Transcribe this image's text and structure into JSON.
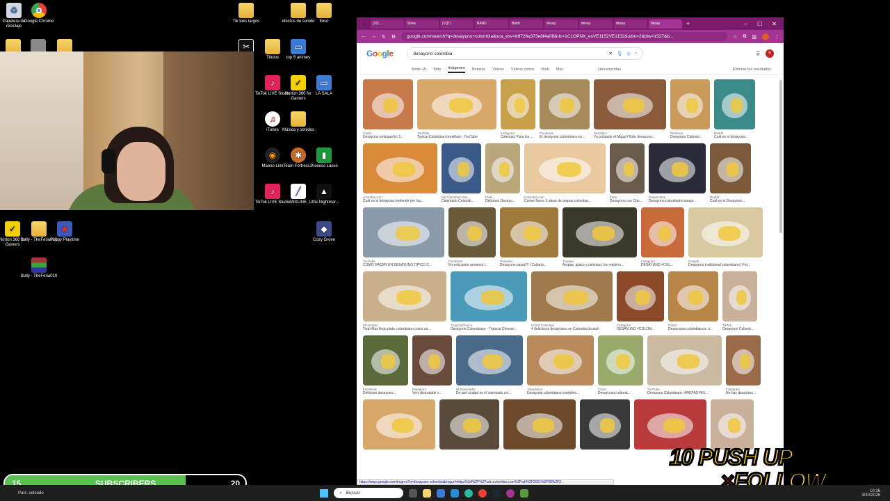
{
  "desktop": {
    "icons": [
      {
        "label": "Papelera de reciclaje",
        "icon": "recycle-bin-icon"
      },
      {
        "label": "Google Chrome",
        "icon": "chrome-icon"
      },
      {
        "label": "Tik toks largos",
        "icon": "folder-icon"
      },
      {
        "label": "efectos de sonido",
        "icon": "folder-icon"
      },
      {
        "label": "ftoso",
        "icon": "folder-icon"
      },
      {
        "label": "Títulos",
        "icon": "folder-icon"
      },
      {
        "label": "top 5 animes",
        "icon": "file-icon"
      },
      {
        "label": "TikTok LIVE Studio",
        "icon": "tiktok-icon"
      },
      {
        "label": "Norton 360 for Gamers",
        "icon": "norton-icon"
      },
      {
        "label": "LA SALA",
        "icon": "file-icon"
      },
      {
        "label": "iTunes",
        "icon": "itunes-icon"
      },
      {
        "label": "Música y sonidos",
        "icon": "folder-icon"
      },
      {
        "label": "Maono Link",
        "icon": "maono-icon"
      },
      {
        "label": "Team Fortress...",
        "icon": "tf2-icon"
      },
      {
        "label": "Process Lasso",
        "icon": "lasso-icon"
      },
      {
        "label": "TikTok LIVE Studio",
        "icon": "tiktok-icon"
      },
      {
        "label": "MIXLINE",
        "icon": "mixline-icon"
      },
      {
        "label": "Little Nightmar...",
        "icon": "game-icon"
      },
      {
        "label": "Cozy Grove",
        "icon": "game-icon"
      },
      {
        "label": "Norton 360 for Gamers",
        "icon": "norton-icon"
      },
      {
        "label": "Bully - TheFeria010",
        "icon": "folder-icon"
      },
      {
        "label": "Poppy Playtime",
        "icon": "game-icon"
      },
      {
        "label": "Bully - TheFeria010",
        "icon": "winrar-icon"
      }
    ]
  },
  "browser": {
    "tabs": [
      "(37) ...",
      "Strea",
      "(1QT)",
      "BAND",
      "Band",
      "desay",
      "desay",
      "desay",
      "desay"
    ],
    "url": "google.com/search?q=desayuno+colombia&sca_esv=b9726a373e8f4a08&rlz=1C1OPNX_esVE1152VE1152&udm=2&biw=1527&b...",
    "search_query": "desayuno colombia",
    "nav_tabs": [
      "Modo IA",
      "Todo",
      "Imágenes",
      "Noticias",
      "Videos",
      "Vídeos cortos",
      "Web",
      "Más"
    ],
    "active_tab": "Imágenes",
    "tools_label": "Herramientas",
    "safesearch_label": "Eliminar los resultados",
    "results": [
      [
        {
          "src": "Canal",
          "title": "Desayuno antioqueño: 5...",
          "color": "#c97a4a",
          "w": 72
        },
        {
          "src": "YouTube",
          "title": "Typical Colombian breakfast - YouTube",
          "color": "#d9a76a",
          "w": 114
        },
        {
          "src": "Instagram",
          "title": "Calentao: Para los ...",
          "color": "#c9a04a",
          "w": 50
        },
        {
          "src": "Facebook",
          "title": "El desayuno colombiano es...",
          "color": "#a68a5a",
          "w": 72
        },
        {
          "src": "Periódico",
          "title": "Ya probaste el Migao? Este desayuno...",
          "color": "#8a5a3a",
          "w": 104
        },
        {
          "src": "Pinterest",
          "title": "Desayuno Colomb...",
          "color": "#c99a5a",
          "w": 57
        },
        {
          "src": "Reddit",
          "title": "Cuál es el desayuno...",
          "color": "#3a8a8a",
          "w": 59
        }
      ],
      [
        {
          "src": "colombia.com",
          "title": "Cuál es el desayuno preferido por los...",
          "color": "#d98a3a",
          "w": 107
        },
        {
          "src": "My Colombian Rec...",
          "title": "Calentado Colombi...",
          "color": "#3a5a8a",
          "w": 57
        },
        {
          "src": "Flickr",
          "title": "Delicioso Desayu...",
          "color": "#b9a67a",
          "w": 50
        },
        {
          "src": "Colombia.com",
          "title": "Comer fuera: 5 ideas de arepas colombia...",
          "color": "#e9c9a0",
          "w": 117
        },
        {
          "src": "Flickr",
          "title": "Desayuno con Cho...",
          "color": "#6a5a4a",
          "w": 50
        },
        {
          "src": "Dreamstime",
          "title": "Desayuno colombiano image...",
          "color": "#2a2a3a",
          "w": 82
        },
        {
          "src": "Reddit",
          "title": "Cuál es el Desayuno...",
          "color": "#7a5a3a",
          "w": 59
        }
      ],
      [
        {
          "src": "YouTube",
          "title": "CÓMO HACER UN DESAYUNO TÍPICO C...",
          "color": "#8a9aaa",
          "w": 117
        },
        {
          "src": "Facebook",
          "title": "En esta parte amamos l...",
          "color": "#6a5a3a",
          "w": 68
        },
        {
          "src": "Pinterest",
          "title": "Desayuno paisa!!!! | Colomb...",
          "color": "#a07a3a",
          "w": 84
        },
        {
          "src": "Traveler",
          "title": "Arepas, ajiaco y calentao: los mejores...",
          "color": "#3a3a2a",
          "w": 107
        },
        {
          "src": "Instagram",
          "title": "DESAYUNO #COL...",
          "color": "#c96a3a",
          "w": 62
        },
        {
          "src": "Freepik",
          "title": "Desayuno tradicional colombiano | Fot...",
          "color": "#d9c9a0",
          "w": 107
        }
      ],
      [
        {
          "src": "El Heraldo",
          "title": "Todo Mas llego plato colombiano como un...",
          "color": "#c9b08a",
          "w": 120
        },
        {
          "src": "Tropical Choice",
          "title": "Desayuno Colombiano - Tropical Cheese...",
          "color": "#4a9ab9",
          "w": 110
        },
        {
          "src": "Unicef Colombia",
          "title": "4 deliciosos desayunos en Colombia brunch",
          "color": "#a07a4a",
          "w": 117
        },
        {
          "src": "Instagram",
          "title": "DESAYUNO #COLOM...",
          "color": "#8a4a2a",
          "w": 68
        },
        {
          "src": "Canal",
          "title": "Desayunos colombianos: u...",
          "color": "#b9864a",
          "w": 72
        },
        {
          "src": "TikTok",
          "title": "Desayuno Colomb...",
          "color": "#c9b09a",
          "w": 50
        }
      ],
      [
        {
          "src": "Facebook",
          "title": "Delicioso desayuno...",
          "color": "#5a6a3a",
          "w": 65
        },
        {
          "src": "Instagram",
          "title": "Very distrutable v...",
          "color": "#6a4a3a",
          "w": 57
        },
        {
          "src": "El Espectador",
          "title": "De qué ciudad es el calentado col...",
          "color": "#4a6a8a",
          "w": 96
        },
        {
          "src": "Tripadvisor",
          "title": "Desayuno colombiano completo...",
          "color": "#b98a5a",
          "w": 96
        },
        {
          "src": "Canal",
          "title": "Desayunos colomb...",
          "color": "#9aaa6a",
          "w": 65
        },
        {
          "src": "YouTube",
          "title": "Desayuno Colombiano, AREPAS REL...",
          "color": "#c9b9a0",
          "w": 107
        },
        {
          "src": "Instagram",
          "title": "No hay desayuno...",
          "color": "#9a6a4a",
          "w": 50
        }
      ],
      [
        {
          "src": "",
          "title": "",
          "color": "#d9a66a",
          "w": 104
        },
        {
          "src": "",
          "title": "",
          "color": "#5a4a3a",
          "w": 86
        },
        {
          "src": "",
          "title": "",
          "color": "#6a4a2a",
          "w": 104
        },
        {
          "src": "",
          "title": "",
          "color": "#3a3a3a",
          "w": 72
        },
        {
          "src": "",
          "title": "",
          "color": "#b93a3a",
          "w": 104
        },
        {
          "src": "",
          "title": "",
          "color": "#c9b09a",
          "w": 62
        }
      ]
    ],
    "status_url": "https://www.google.com/imgres?q=desayuno colombia&imgurl=https%3A%2F%2Fcdn.colombia.com%2Fsdi%2F2021%2F08%2F2..."
  },
  "overlay": {
    "sub_start": "15",
    "sub_label": "SUBSCRIBERS",
    "sub_goal": "20",
    "sub_progress": 0.75,
    "promo_line1": "10 PUSH UP",
    "promo_x": "×",
    "promo_line2": "FOLLOW"
  },
  "taskbar": {
    "weather": "Parc. soleado",
    "search_placeholder": "Buscar",
    "time": "10:16",
    "date": "3/30/2026"
  },
  "colors": {
    "tabbar": "#7b1b6e",
    "sub_fill": "#58c14f",
    "promo_text": "#ffd400"
  }
}
